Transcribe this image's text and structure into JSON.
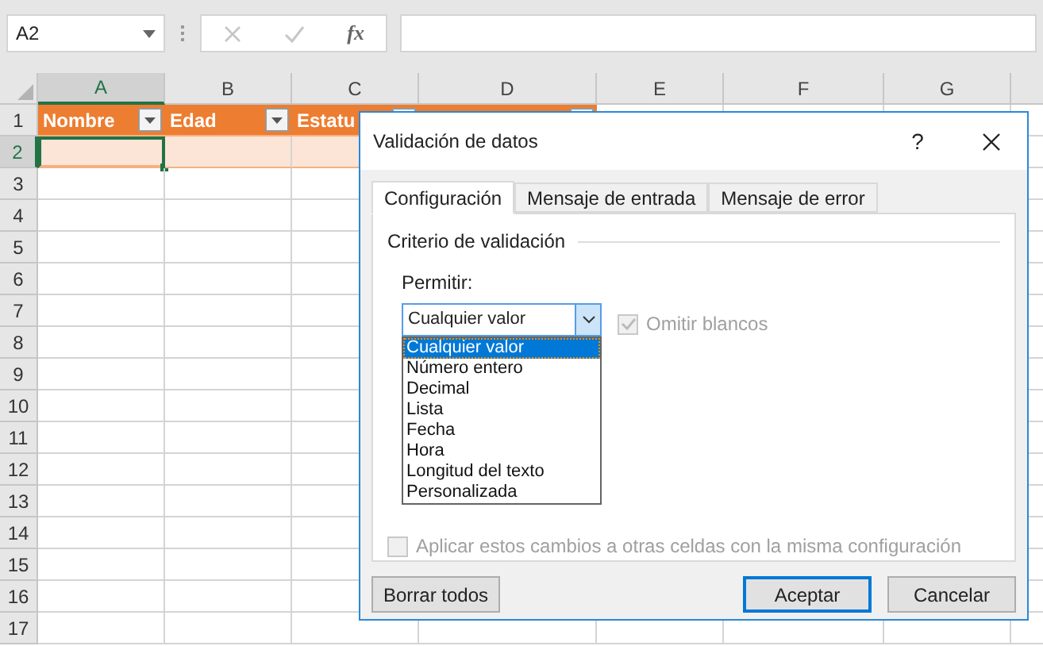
{
  "name_box": {
    "value": "A2"
  },
  "formula_bar": {
    "function_label": "fx"
  },
  "sheet": {
    "columns": [
      {
        "label": "A",
        "selected": true
      },
      {
        "label": "B",
        "selected": false
      },
      {
        "label": "C",
        "selected": false
      },
      {
        "label": "D",
        "selected": false
      },
      {
        "label": "E",
        "selected": false
      },
      {
        "label": "F",
        "selected": false
      },
      {
        "label": "G",
        "selected": false
      }
    ],
    "rows": [
      {
        "label": "1",
        "selected": false
      },
      {
        "label": "2",
        "selected": true
      },
      {
        "label": "3",
        "selected": false
      },
      {
        "label": "4",
        "selected": false
      },
      {
        "label": "5",
        "selected": false
      },
      {
        "label": "6",
        "selected": false
      },
      {
        "label": "7",
        "selected": false
      },
      {
        "label": "8",
        "selected": false
      },
      {
        "label": "9",
        "selected": false
      },
      {
        "label": "10",
        "selected": false
      },
      {
        "label": "11",
        "selected": false
      },
      {
        "label": "12",
        "selected": false
      },
      {
        "label": "13",
        "selected": false
      },
      {
        "label": "14",
        "selected": false
      },
      {
        "label": "15",
        "selected": false
      },
      {
        "label": "16",
        "selected": false
      },
      {
        "label": "17",
        "selected": false
      }
    ],
    "table_headers": [
      {
        "text": "Nombre",
        "filter": true
      },
      {
        "text": "Edad",
        "filter": true
      },
      {
        "text": "Estatu",
        "filter": true
      },
      {
        "filter": true
      }
    ]
  },
  "dialog": {
    "title": "Validación de datos",
    "help": "?",
    "tabs": [
      {
        "label": "Configuración",
        "selected": true
      },
      {
        "label": "Mensaje de entrada",
        "selected": false
      },
      {
        "label": "Mensaje de error",
        "selected": false
      }
    ],
    "section_title": "Criterio de validación",
    "allow_label": "Permitir:",
    "allow_combo": {
      "value": "Cualquier valor",
      "expanded": true,
      "options": [
        {
          "label": "Cualquier valor",
          "selected": true
        },
        {
          "label": "Número entero",
          "selected": false
        },
        {
          "label": "Decimal",
          "selected": false
        },
        {
          "label": "Lista",
          "selected": false
        },
        {
          "label": "Fecha",
          "selected": false
        },
        {
          "label": "Hora",
          "selected": false
        },
        {
          "label": "Longitud del texto",
          "selected": false
        },
        {
          "label": "Personalizada",
          "selected": false
        }
      ]
    },
    "ignore_blank": {
      "label": "Omitir blancos",
      "checked": true,
      "disabled": true
    },
    "apply_all": {
      "label": "Aplicar estos cambios a otras celdas con la misma configuración",
      "checked": false,
      "disabled": true
    },
    "buttons": [
      {
        "label": "Borrar todos",
        "default": false
      },
      {
        "label": "Aceptar",
        "default": true
      },
      {
        "label": "Cancelar",
        "default": false
      }
    ]
  }
}
